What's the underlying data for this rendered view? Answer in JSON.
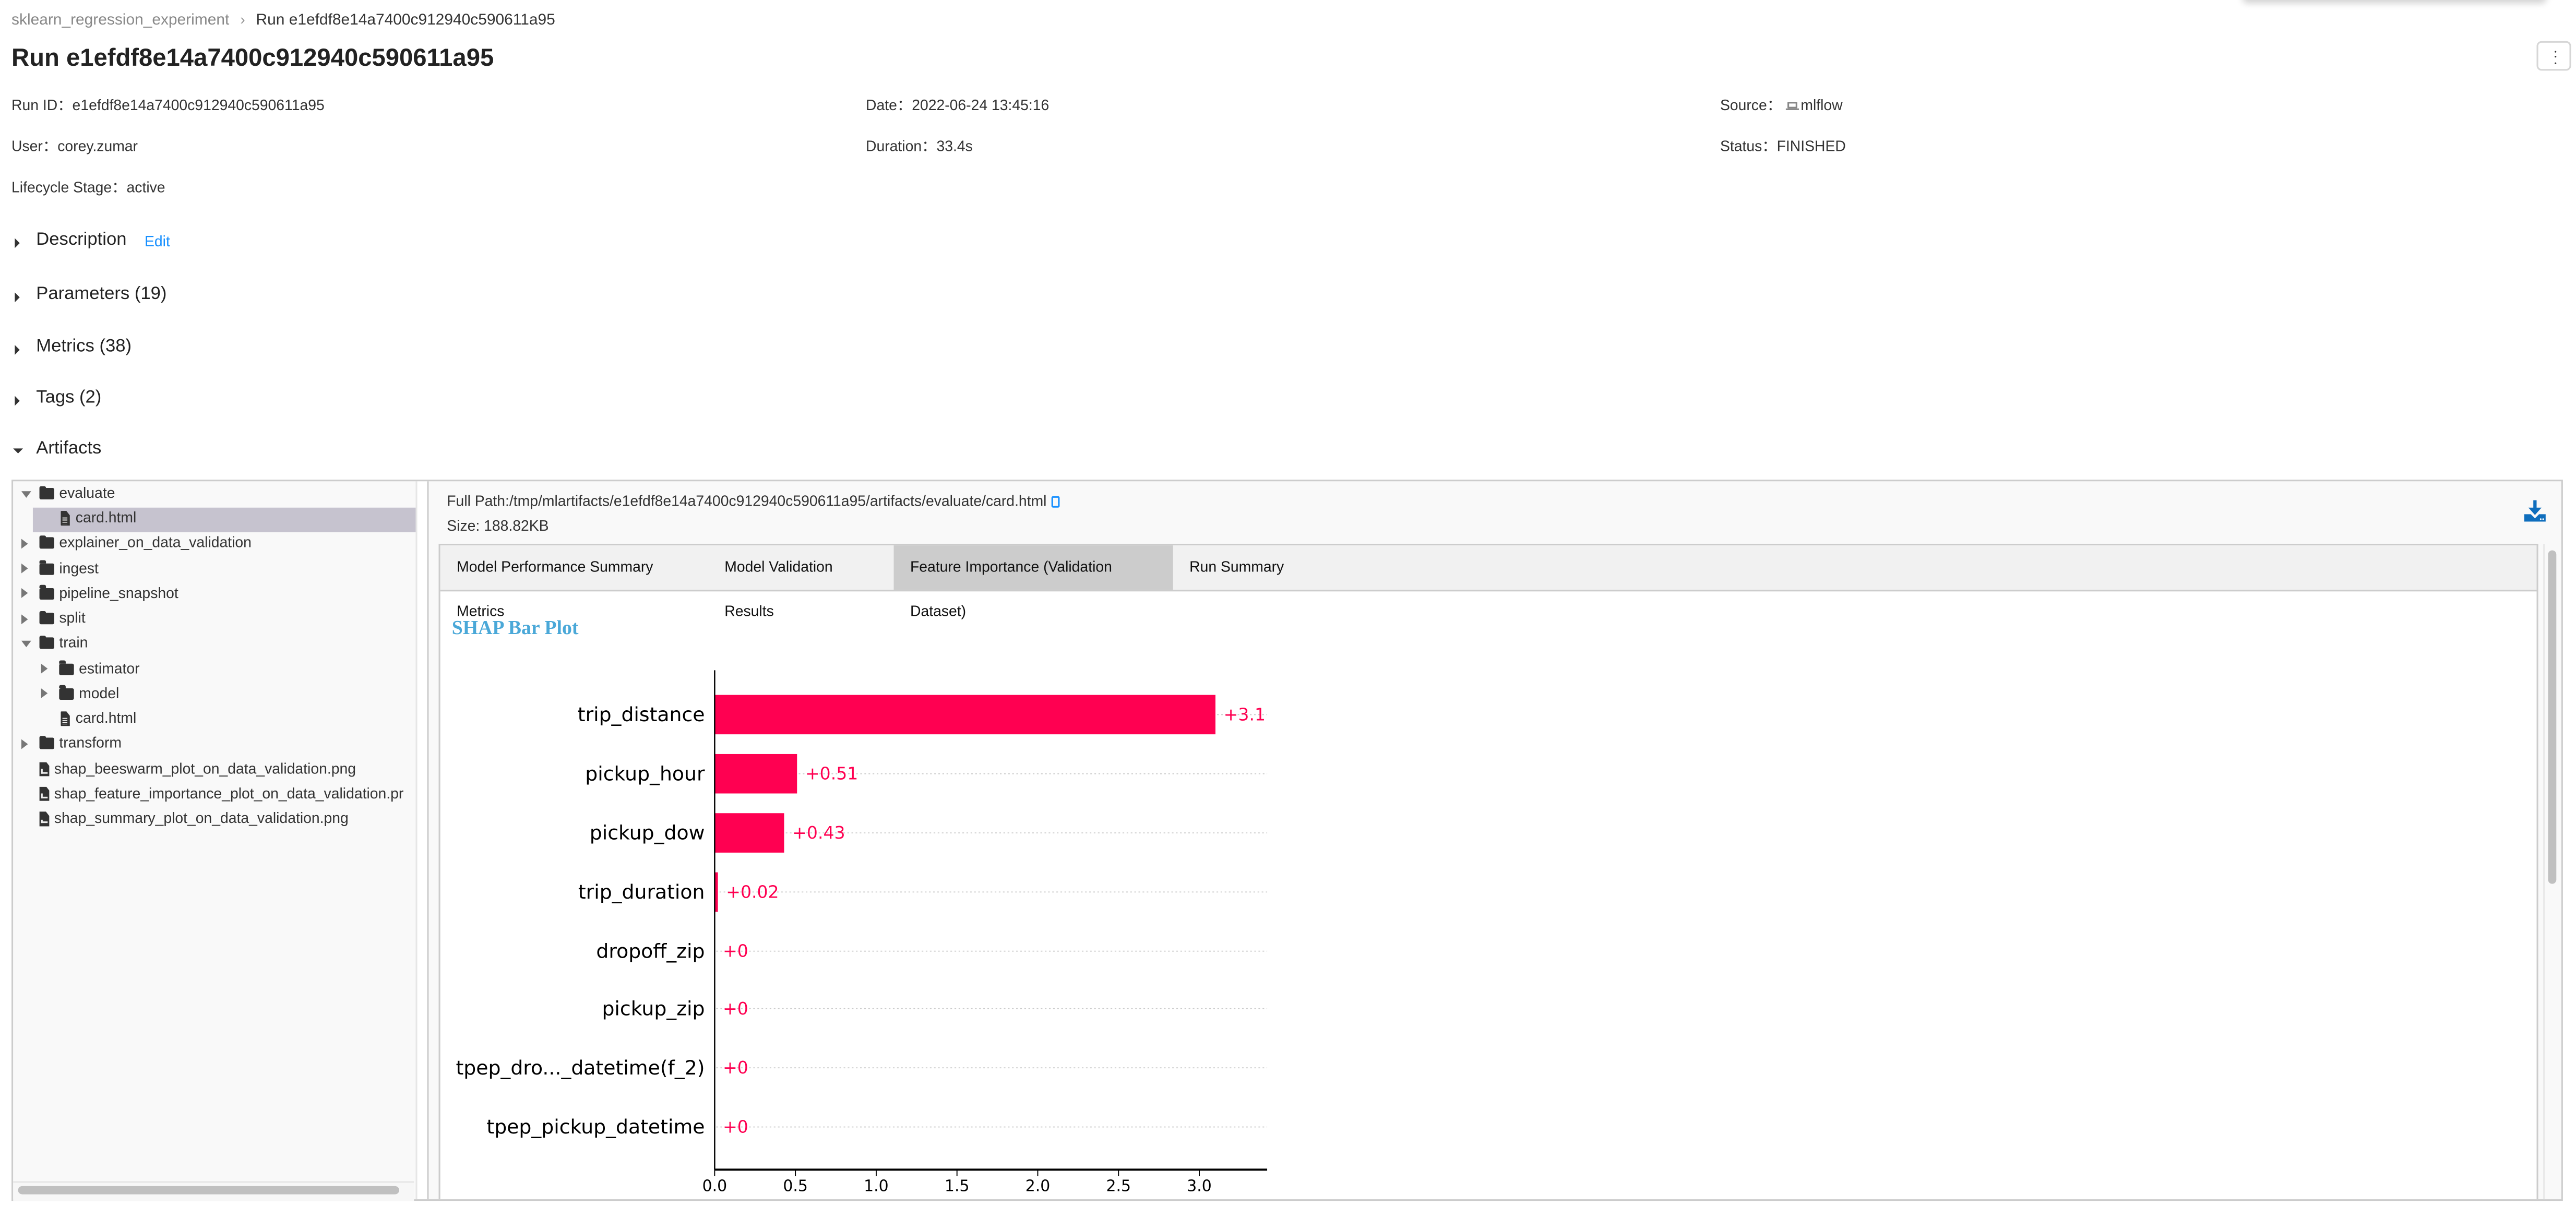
{
  "breadcrumb": {
    "experiment": "sklearn_regression_experiment",
    "separator": "›",
    "current": "Run e1efdf8e14a7400c912940c590611a95"
  },
  "page_title": "Run e1efdf8e14a7400c912940c590611a95",
  "overflow_menu_icon": "more-vertical-icon",
  "metadata": {
    "run_id": {
      "label": "Run ID：",
      "value": "e1efdf8e14a7400c912940c590611a95"
    },
    "date": {
      "label": "Date：",
      "value": "2022-06-24 13:45:16"
    },
    "source": {
      "label": "Source：",
      "icon": "laptop-icon",
      "value": "mlflow"
    },
    "user": {
      "label": "User：",
      "value": "corey.zumar"
    },
    "duration": {
      "label": "Duration：",
      "value": "33.4s"
    },
    "status": {
      "label": "Status：",
      "value": "FINISHED"
    },
    "lifecycle": {
      "label": "Lifecycle Stage：",
      "value": "active"
    }
  },
  "sections": {
    "description": {
      "label": "Description",
      "edit": "Edit",
      "expanded": false
    },
    "parameters": {
      "label": "Parameters (19)",
      "expanded": false
    },
    "metrics": {
      "label": "Metrics (38)",
      "expanded": false
    },
    "tags": {
      "label": "Tags (2)",
      "expanded": false
    },
    "artifacts": {
      "label": "Artifacts",
      "expanded": true
    }
  },
  "artifact_tree": [
    {
      "label": "evaluate",
      "type": "folder",
      "expanded": true,
      "depth": 0
    },
    {
      "label": "card.html",
      "type": "file",
      "depth": 1,
      "selected": true
    },
    {
      "label": "explainer_on_data_validation",
      "type": "folder",
      "expanded": false,
      "depth": 0
    },
    {
      "label": "ingest",
      "type": "folder",
      "expanded": false,
      "depth": 0
    },
    {
      "label": "pipeline_snapshot",
      "type": "folder",
      "expanded": false,
      "depth": 0
    },
    {
      "label": "split",
      "type": "folder",
      "expanded": false,
      "depth": 0
    },
    {
      "label": "train",
      "type": "folder",
      "expanded": true,
      "depth": 0
    },
    {
      "label": "estimator",
      "type": "folder",
      "expanded": false,
      "depth": 1
    },
    {
      "label": "model",
      "type": "folder",
      "expanded": false,
      "depth": 1
    },
    {
      "label": "card.html",
      "type": "file",
      "depth": 1
    },
    {
      "label": "transform",
      "type": "folder",
      "expanded": false,
      "depth": 0
    },
    {
      "label": "shap_beeswarm_plot_on_data_validation.png",
      "type": "image",
      "depth": 0
    },
    {
      "label": "shap_feature_importance_plot_on_data_validation.pr",
      "type": "image",
      "depth": 0
    },
    {
      "label": "shap_summary_plot_on_data_validation.png",
      "type": "image",
      "depth": 0
    }
  ],
  "viewer": {
    "full_path": "Full Path:/tmp/mlartifacts/e1efdf8e14a7400c912940c590611a95/artifacts/evaluate/card.html",
    "size": "Size: 188.82KB",
    "copy_icon": "copy-icon",
    "download_icon": "download-icon",
    "tabs": [
      {
        "label": "Model Performance Summary Metrics",
        "active": false
      },
      {
        "label": "Model Validation Results",
        "active": false
      },
      {
        "label": "Feature Importance (Validation Dataset)",
        "active": true
      },
      {
        "label": "Run Summary",
        "active": false
      }
    ],
    "section_title": "SHAP Bar Plot"
  },
  "colors": {
    "bar": "#ff0051",
    "link": "#1890ff",
    "shap_title": "#4aa8d8",
    "selected_row": "#c6c3cf",
    "active_tab": "#cccccc"
  },
  "chart_data": {
    "type": "bar",
    "orientation": "horizontal",
    "title": "SHAP Bar Plot",
    "categories": [
      "trip_distance",
      "pickup_hour",
      "pickup_dow",
      "trip_duration",
      "dropoff_zip",
      "pickup_zip",
      "tpep_dro..._datetime(f_2)",
      "tpep_pickup_datetime"
    ],
    "values": [
      3.1,
      0.51,
      0.43,
      0.02,
      0,
      0,
      0,
      0
    ],
    "value_labels": [
      "+3.1",
      "+0.51",
      "+0.43",
      "+0.02",
      "+0",
      "+0",
      "+0",
      "+0"
    ],
    "xlabel": "",
    "ylabel": "",
    "xlim": [
      0,
      3.42
    ],
    "xticks": [
      0.0,
      0.5,
      1.0,
      1.5,
      2.0,
      2.5,
      3.0
    ],
    "xtick_labels": [
      "0.0",
      "0.5",
      "1.0",
      "1.5",
      "2.0",
      "2.5",
      "3.0"
    ],
    "grid": "dotted row guides",
    "legend": "none"
  }
}
